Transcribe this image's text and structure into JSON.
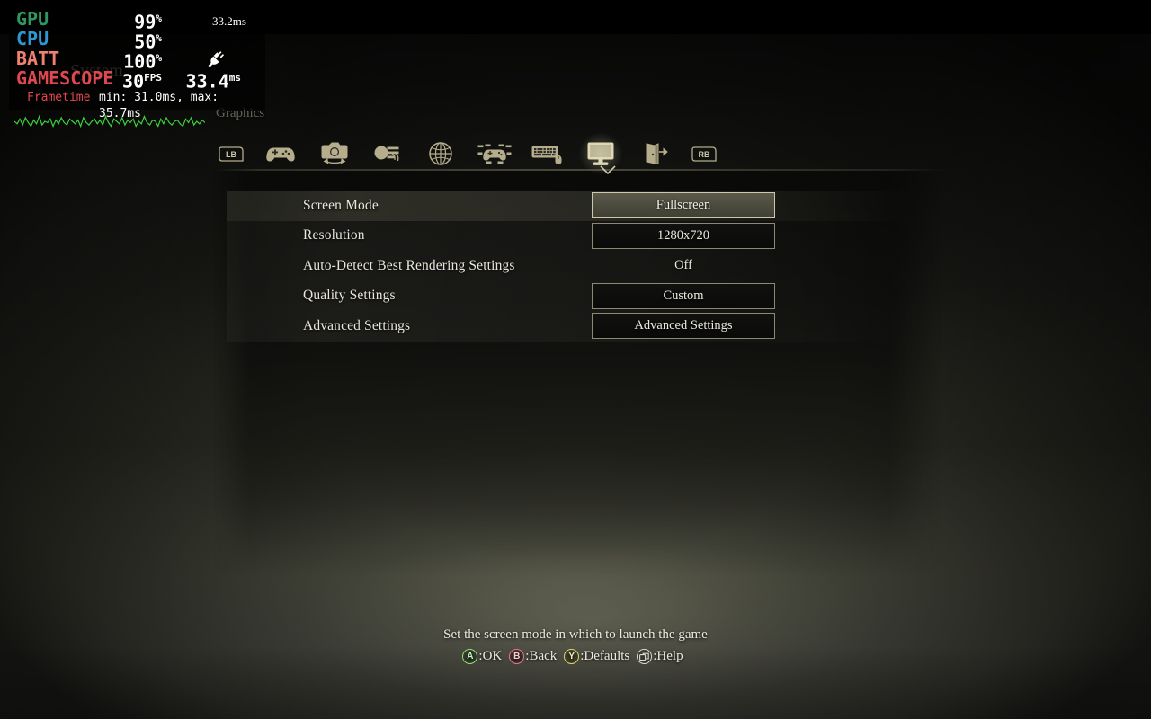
{
  "scene": {
    "screen_title": "System",
    "screen_subtitle": "Graphics"
  },
  "tabs": [
    {
      "name": "bumper-left",
      "label": "LB",
      "selected": false
    },
    {
      "name": "tab-gamepad",
      "label": "Gamepad",
      "selected": false
    },
    {
      "name": "tab-camera",
      "label": "Camera",
      "selected": false
    },
    {
      "name": "tab-audio",
      "label": "Audio",
      "selected": false
    },
    {
      "name": "tab-language",
      "label": "Language",
      "selected": false
    },
    {
      "name": "tab-controller",
      "label": "Controller Settings",
      "selected": false
    },
    {
      "name": "tab-keyboard-mouse",
      "label": "Keyboard & Mouse",
      "selected": false
    },
    {
      "name": "tab-graphics",
      "label": "Graphics",
      "selected": true
    },
    {
      "name": "tab-exit",
      "label": "Exit",
      "selected": false
    },
    {
      "name": "bumper-right",
      "label": "RB",
      "selected": false
    }
  ],
  "settings": {
    "rows": [
      {
        "label": "Screen Mode",
        "value": "Fullscreen",
        "boxed": true,
        "selected": true
      },
      {
        "label": "Resolution",
        "value": "1280x720",
        "boxed": true,
        "selected": false
      },
      {
        "label": "Auto-Detect Best Rendering Settings",
        "value": "Off",
        "boxed": false,
        "selected": false
      },
      {
        "label": "Quality Settings",
        "value": "Custom",
        "boxed": true,
        "selected": false
      },
      {
        "label": "Advanced Settings",
        "value": "Advanced Settings",
        "boxed": true,
        "selected": false
      }
    ]
  },
  "help": {
    "description": "Set the screen mode in which to launch the game",
    "buttons": [
      {
        "glyph": "A",
        "kind": "a",
        "label": ":OK"
      },
      {
        "glyph": "B",
        "kind": "b",
        "label": ":Back"
      },
      {
        "glyph": "Y",
        "kind": "y",
        "label": ":Defaults"
      },
      {
        "glyph": "",
        "kind": "help",
        "label": ":Help"
      }
    ]
  },
  "hud": {
    "rows": [
      {
        "key": "GPU",
        "color": "#2e9762",
        "value": "99",
        "unit": "%"
      },
      {
        "key": "CPU",
        "color": "#2e97d4",
        "value": "50",
        "unit": "%"
      },
      {
        "key": "BATT",
        "color": "#f08070",
        "value": "100",
        "unit": "%"
      },
      {
        "key": "GAMESCOPE",
        "color": "#e04850",
        "value": "30",
        "unit": "FPS"
      }
    ],
    "gamescope_frametime": "33.4",
    "gamescope_frametime_unit": "ms",
    "frametime_label": "Frametime",
    "frametime_minmax": "min: 31.0ms, max: 35.7ms",
    "frametime_current": "33.2ms",
    "graph_color": "#3bd13b",
    "graph_points": [
      7,
      5,
      9,
      4,
      10,
      6,
      3,
      8,
      5,
      11,
      4,
      7,
      6,
      9,
      3,
      8,
      5,
      10,
      6,
      4,
      9,
      7,
      5,
      8,
      3,
      10,
      6,
      4,
      7,
      9,
      5,
      8,
      4,
      11,
      6,
      3,
      9,
      7,
      5,
      10,
      4,
      8,
      6,
      9,
      3,
      7,
      5,
      11,
      6,
      4,
      8,
      7,
      3,
      9,
      5,
      10,
      6,
      4,
      7,
      8,
      5,
      3,
      9,
      6,
      10,
      4,
      7,
      5,
      8,
      6
    ]
  }
}
